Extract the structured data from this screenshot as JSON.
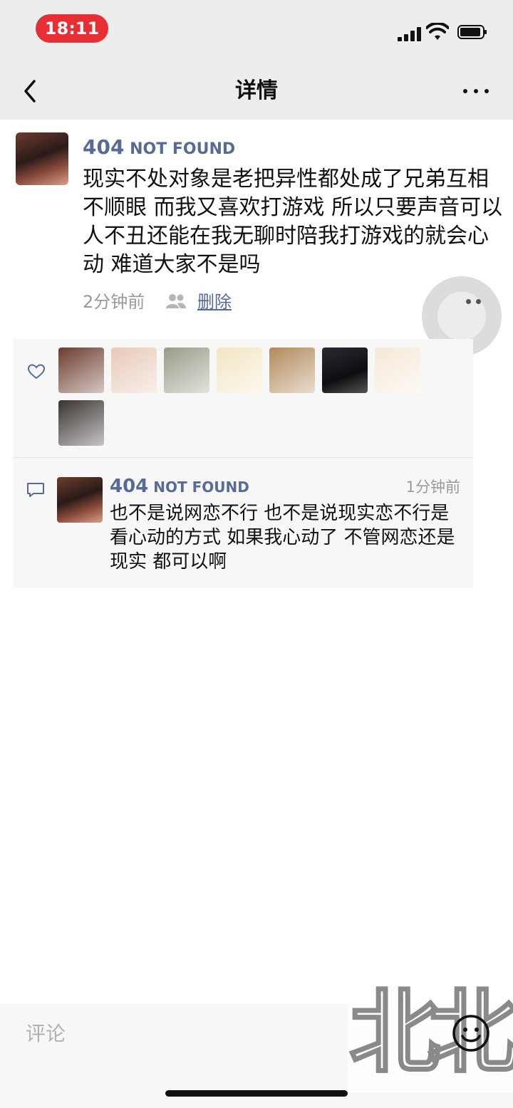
{
  "status_bar": {
    "time": "18:11"
  },
  "nav": {
    "title": "详情"
  },
  "post": {
    "author": "404",
    "author_suffix": " NOT FOUND",
    "text": "现实不处对象是老把异性都处成了兄弟互相不顺眼 而我又喜欢打游戏 所以只要声音可以人不丑还能在我无聊时陪我打游戏的就会心动 难道大家不是吗",
    "time": "2分钟前",
    "delete_label": "删除"
  },
  "likes": {
    "count": 8,
    "avatars": [
      "avatar-woman",
      "avatar-anime-girl",
      "avatar-boy",
      "avatar-skateboard-sketch",
      "avatar-bear-glasses",
      "avatar-anime-boy",
      "avatar-sandwich",
      "avatar-woman-sitting"
    ],
    "colors": [
      "#6b3c2e",
      "#e8c9b8",
      "#9a9a8a",
      "#f2e6c2",
      "#b08a5a",
      "#1f1f24",
      "#f5e9d8",
      "#3a3230"
    ]
  },
  "comment": {
    "author": "404",
    "author_suffix": " NOT FOUND",
    "time": "1分钟前",
    "text": "也不是说网恋不行 也不是说现实恋不行是看心动的方式 如果我心动了 不管网恋还是现实 都可以啊"
  },
  "input": {
    "placeholder": "评论"
  },
  "watermark": {
    "char1": "北",
    "char2": "北"
  },
  "colors": {
    "link": "#576b95",
    "recording": "#e52f35",
    "bar": "#ededed"
  }
}
